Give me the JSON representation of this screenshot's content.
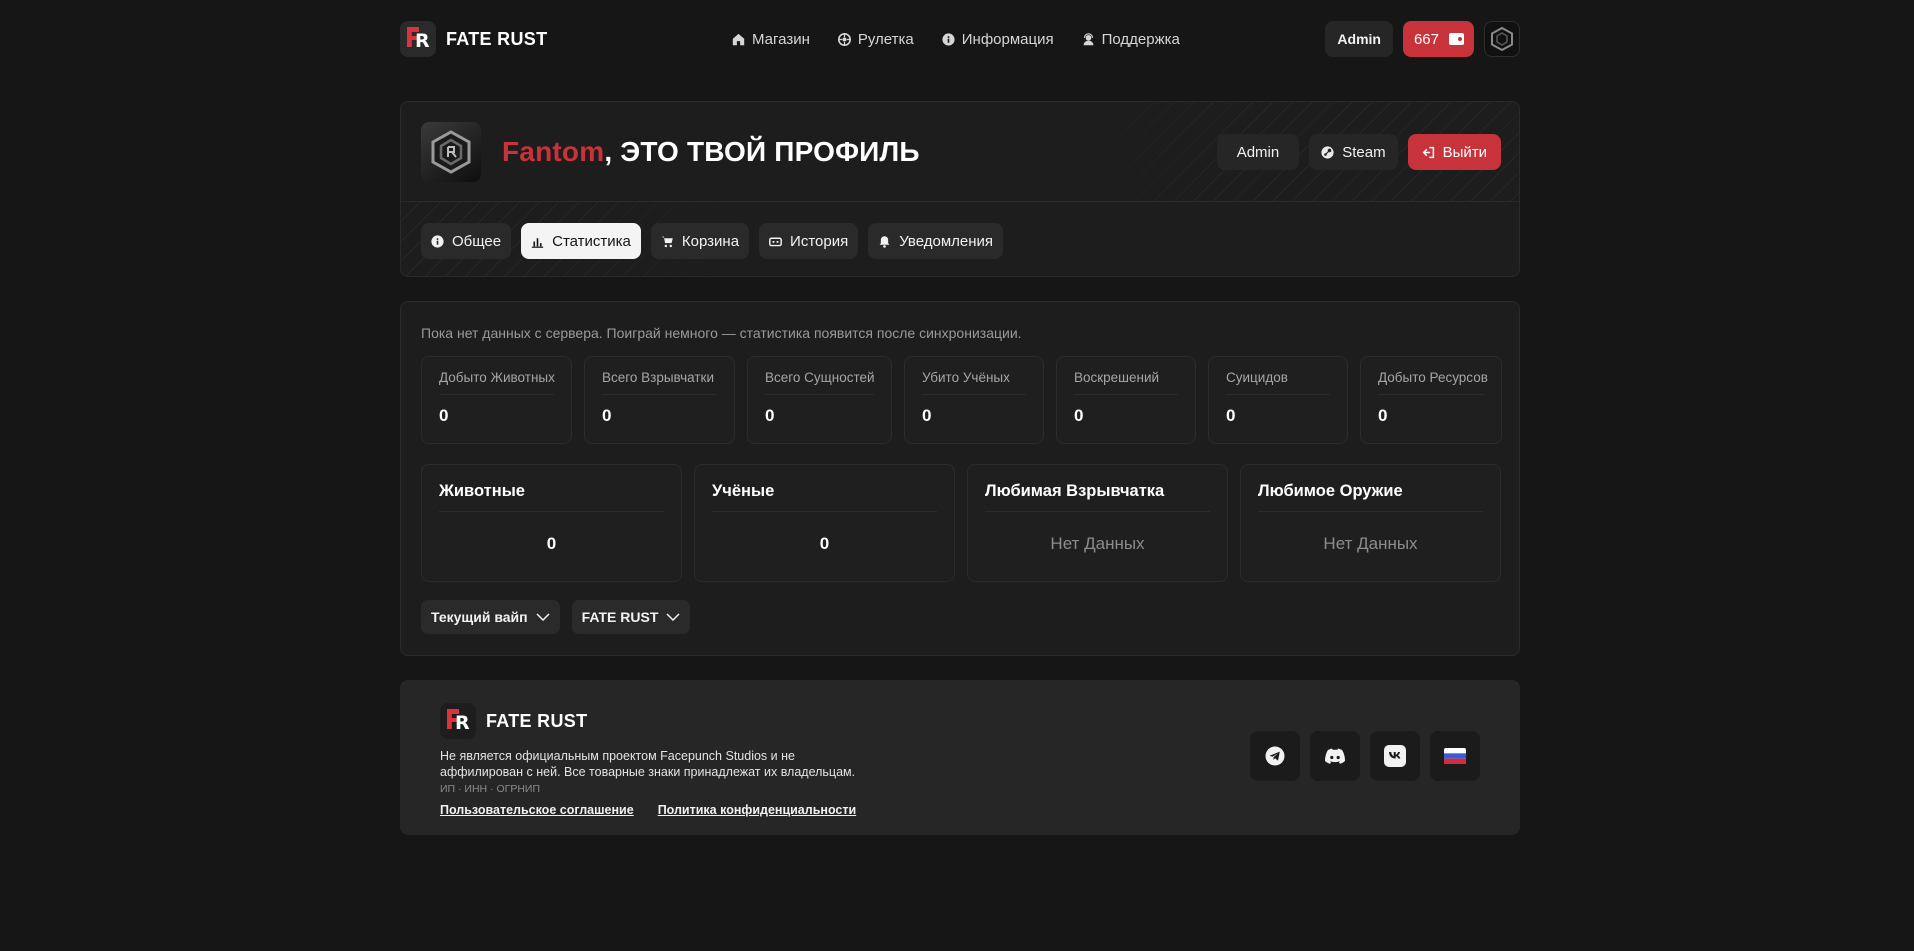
{
  "brand": {
    "name": "FATE RUST"
  },
  "nav": [
    {
      "label": "Магазин",
      "icon": "home-icon"
    },
    {
      "label": "Рулетка",
      "icon": "roulette-icon"
    },
    {
      "label": "Информация",
      "icon": "info-icon"
    },
    {
      "label": "Поддержка",
      "icon": "support-icon"
    }
  ],
  "header": {
    "admin_label": "Admin",
    "balance": "667"
  },
  "profile": {
    "nickname": "Fantom",
    "title_suffix": ", ЭТО ТВОЙ ПРОФИЛЬ",
    "actions": {
      "admin": "Admin",
      "steam": "Steam",
      "logout": "Выйти"
    },
    "tabs": [
      {
        "label": "Общее",
        "icon": "info-icon"
      },
      {
        "label": "Статистика",
        "icon": "chart-icon",
        "active": true
      },
      {
        "label": "Корзина",
        "icon": "cart-icon"
      },
      {
        "label": "История",
        "icon": "history-icon"
      },
      {
        "label": "Уведомления",
        "icon": "bell-icon"
      }
    ]
  },
  "stats": {
    "note": "Пока нет данных с сервера. Поиграй немного — статистика появится после синхронизации.",
    "cards": [
      {
        "label": "Добыто Животных",
        "value": "0"
      },
      {
        "label": "Всего Взрывчатки",
        "value": "0"
      },
      {
        "label": "Всего Сущностей",
        "value": "0"
      },
      {
        "label": "Убито Учёных",
        "value": "0"
      },
      {
        "label": "Воскрешений",
        "value": "0"
      },
      {
        "label": "Суицидов",
        "value": "0"
      },
      {
        "label": "Добыто Ресурсов",
        "value": "0"
      }
    ],
    "big": [
      {
        "title": "Животные",
        "value": "0"
      },
      {
        "title": "Учёные",
        "value": "0"
      },
      {
        "title": "Любимая Взрывчатка",
        "value": "Нет Данных"
      },
      {
        "title": "Любимое Оружие",
        "value": "Нет Данных"
      }
    ],
    "selects": {
      "wipe": "Текущий вайп",
      "server": "FATE RUST"
    }
  },
  "footer": {
    "brand": "FATE RUST",
    "disclaimer": "Не является официальным проектом Facepunch Studios и не аффилирован с ней. Все товарные знаки принадлежат их владельцам.",
    "legal": "ИП · ИНН · ОГРНИП",
    "links": {
      "terms": "Пользовательское соглашение",
      "privacy": "Политика конфиденциальности"
    }
  },
  "colors": {
    "accent": "#c8323a",
    "background": "#161616",
    "card": "#1d1d1d"
  }
}
